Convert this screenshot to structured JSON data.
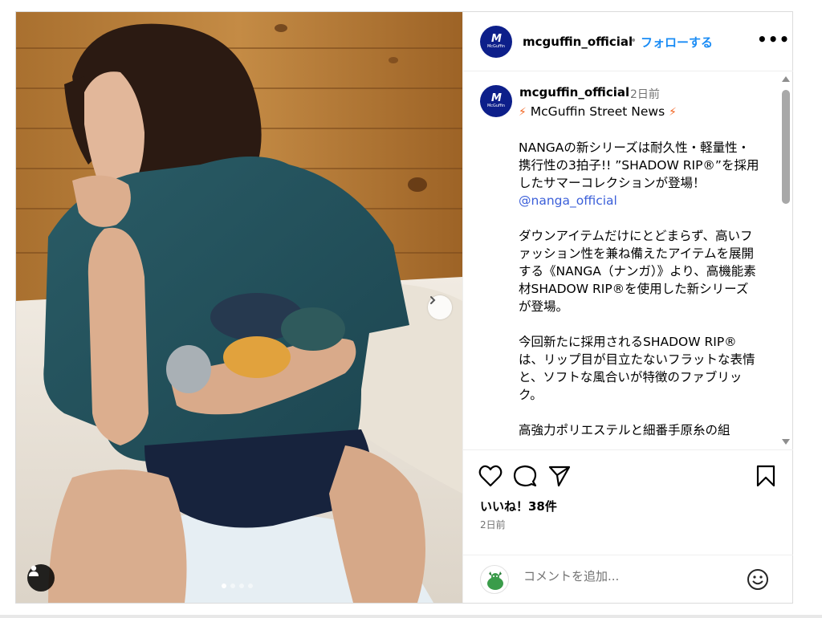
{
  "post": {
    "username": "mcguffin_official",
    "separator": "•",
    "follow_label": "フォローする",
    "more_label": "•••",
    "avatar_mark": "M",
    "avatar_name": "McGuffin"
  },
  "caption": {
    "username": "mcguffin_official",
    "time": "2日前",
    "headline": "McGuffin Street News",
    "paragraph1": "NANGAの新シリーズは耐久性・軽量性・携行性の3拍子!! ”SHADOW RIP®”を採用したサマーコレクションが登場！",
    "mention": "@nanga_official",
    "paragraph2": "ダウンアイテムだけにとどまらず、高いファッション性を兼ね備えたアイテムを展開する《NANGA（ナンガ）》より、高機能素材SHADOW RIP®を使用した新シリーズが登場。",
    "paragraph3": "今回新たに採用されるSHADOW RIP®は、リップ目が目立たないフラットな表情と、ソフトな風合いが特徴のファブリック。",
    "paragraph4": "高強力ポリエステルと細番手原糸の組"
  },
  "actions": {
    "icons": [
      "heart-icon",
      "comment-icon",
      "share-icon",
      "bookmark-icon"
    ],
    "likes": "いいね！38件",
    "time": "2日前"
  },
  "comment": {
    "placeholder": "コメントを追加..."
  },
  "carousel": {
    "slide_count": 4,
    "active_index": 0
  },
  "colors": {
    "follow_blue": "#1a8cf5",
    "mention_blue": "#3b5fd9",
    "avatar_navy": "#0d1f8a",
    "bolt_orange": "#f26522"
  }
}
